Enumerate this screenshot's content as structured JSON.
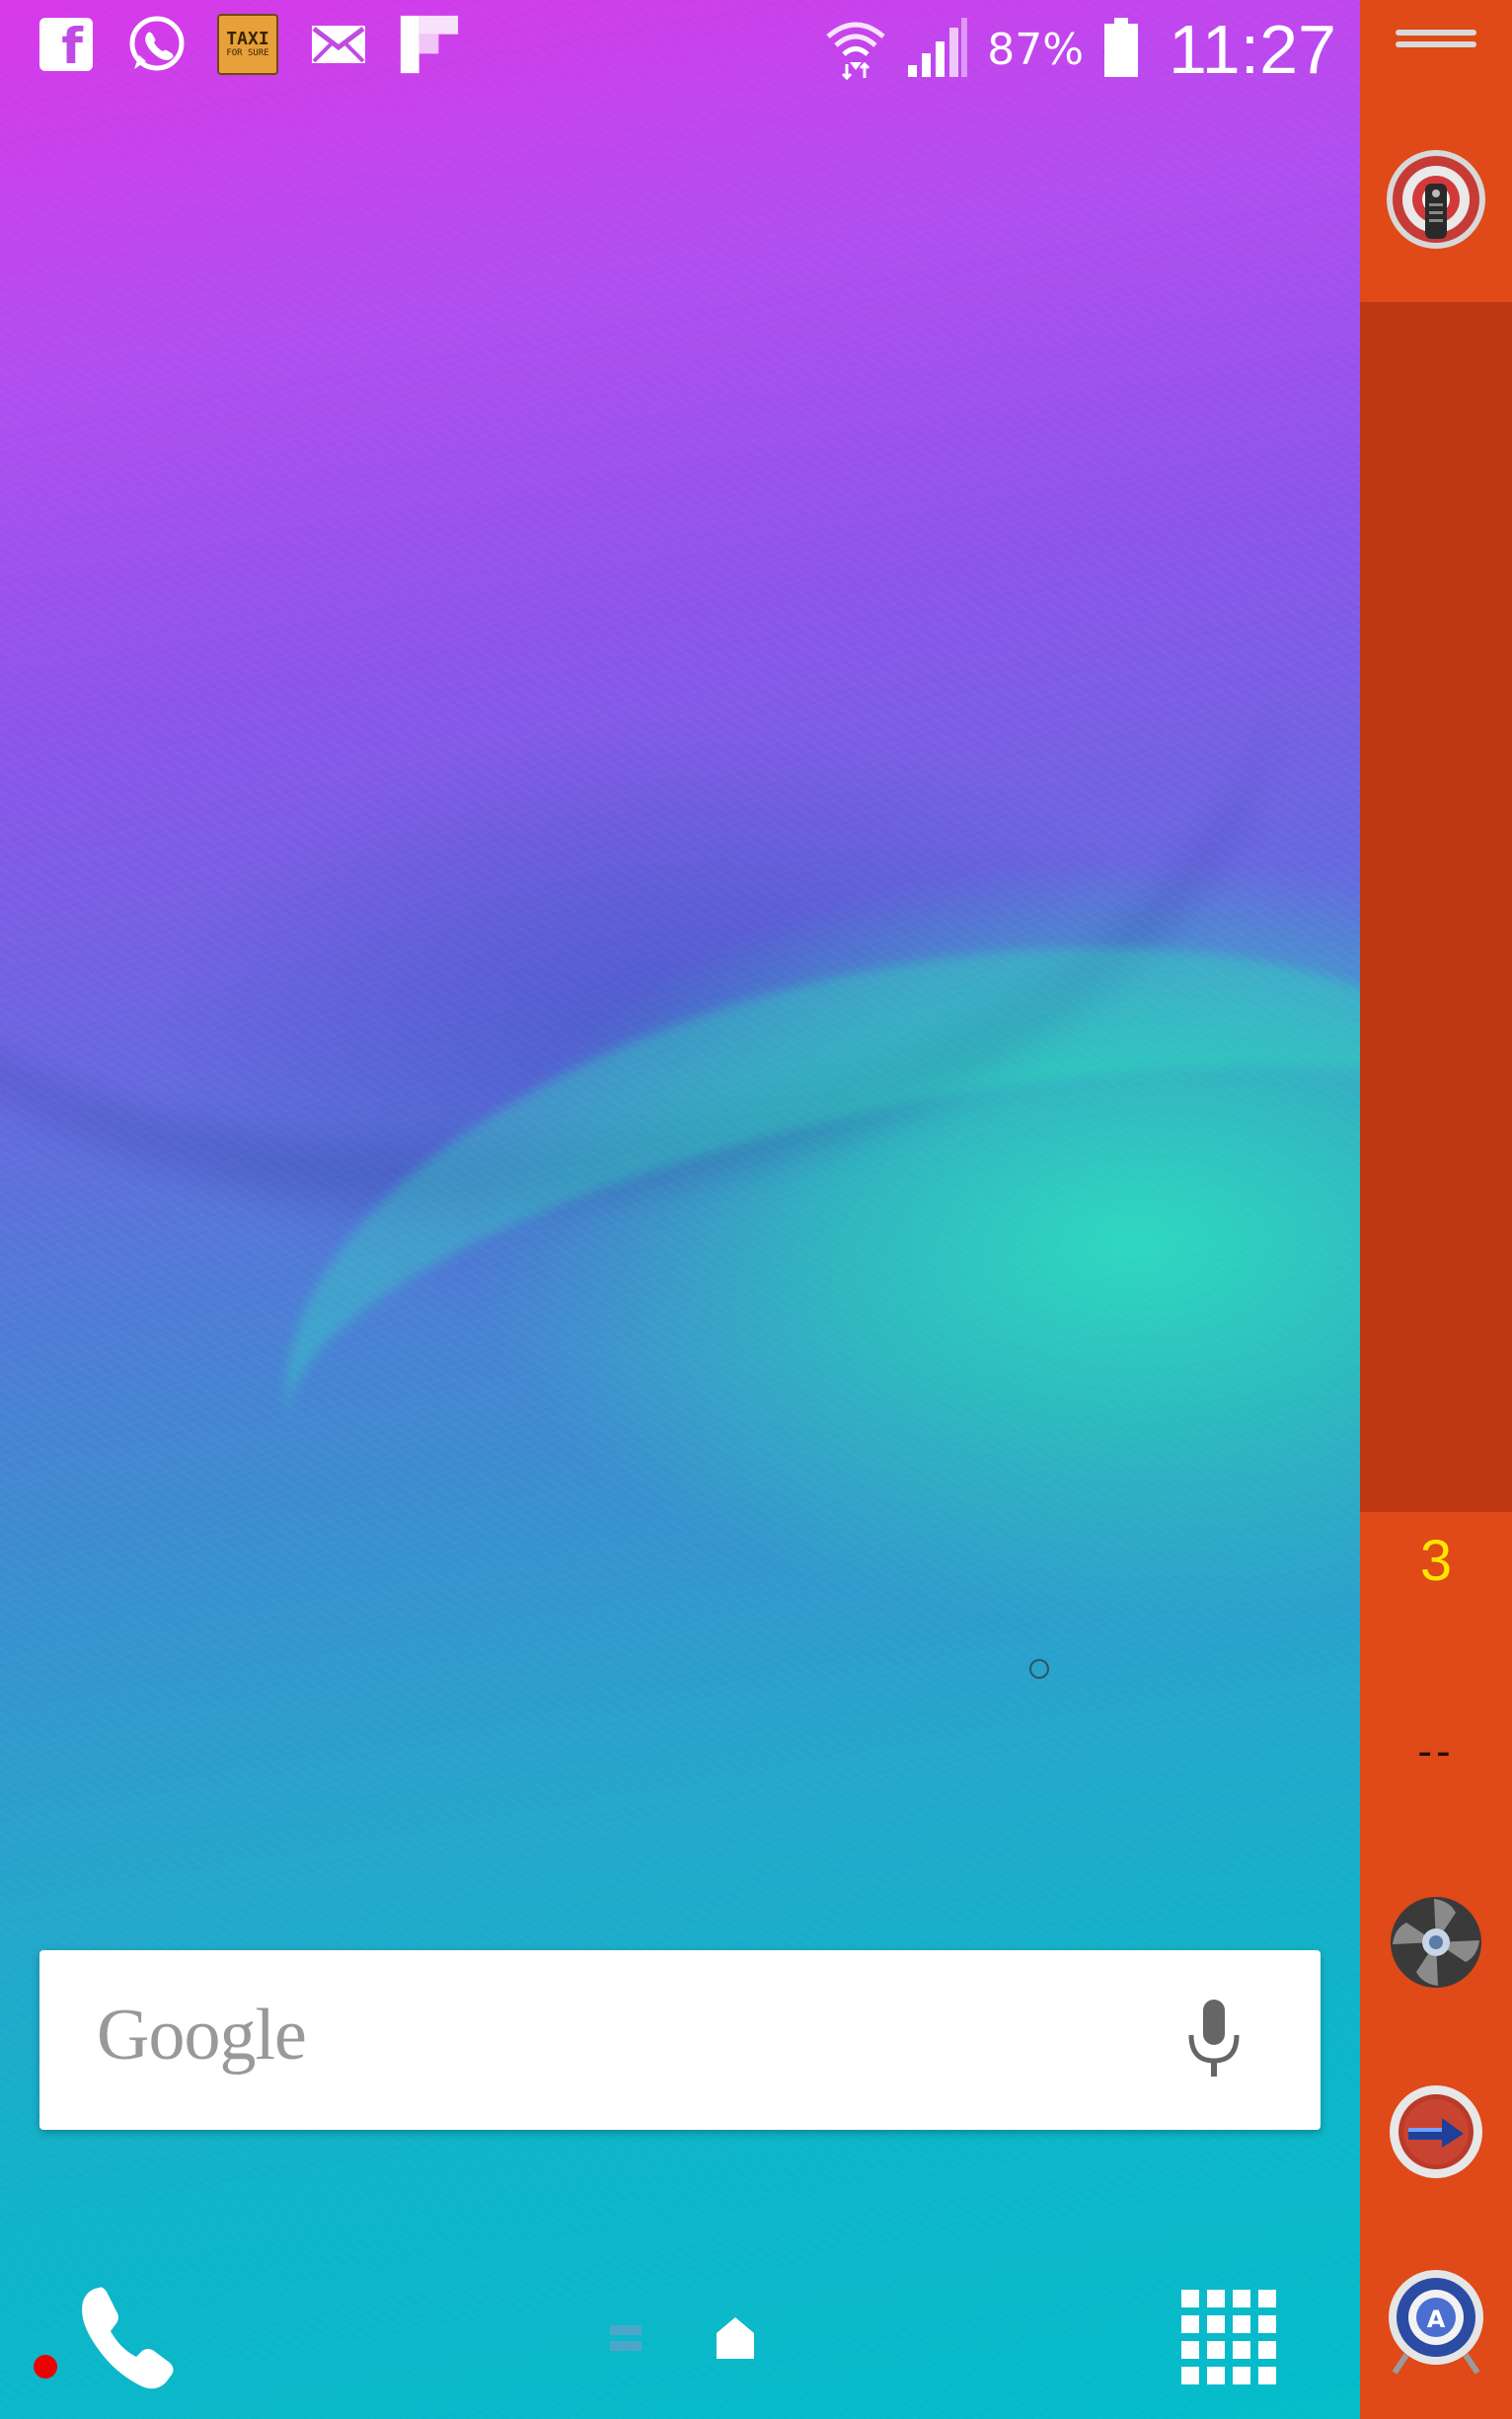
{
  "status_bar": {
    "notification_icons": [
      "facebook-icon",
      "whatsapp-icon",
      "taxi-for-sure-icon",
      "email-icon",
      "flipboard-icon"
    ],
    "taxi_icon_text_top": "TAXI",
    "taxi_icon_text_bottom": "FOR SURE",
    "facebook_glyph": "f",
    "battery_percent": "87%",
    "time": "11:27"
  },
  "edge_panel": {
    "count": "3",
    "dashes": "--",
    "apps": [
      "remote-control-icon",
      "fan-icon",
      "arrow-app-icon",
      "settings-app-icon"
    ],
    "accent_color": "#e04918",
    "dark_color": "#be3912"
  },
  "search_widget": {
    "logo_text": "Google"
  },
  "dock": {
    "items": [
      "phone-icon",
      "page-indicator-icon",
      "home-icon",
      "apps-grid-icon"
    ]
  }
}
